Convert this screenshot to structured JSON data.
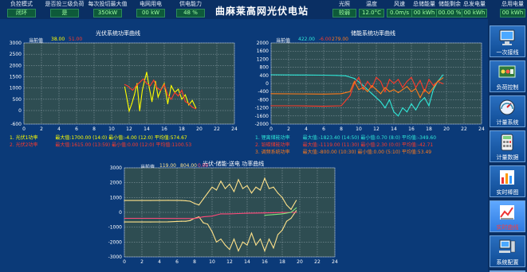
{
  "header": {
    "title": "曲麻莱高网光伏电站",
    "left_fields": [
      {
        "label": "负控模式",
        "value": "闭环"
      },
      {
        "label": "是否投三级负荷",
        "value": "是"
      },
      {
        "label": "每次投切最大值",
        "value": "350kW"
      },
      {
        "label": "电网用电",
        "value": "00 kW"
      },
      {
        "label": "供电能力",
        "value": "48 %"
      }
    ],
    "right_fields": [
      {
        "label": "光照",
        "value": "较弱"
      },
      {
        "label": "温度",
        "value": "12.0°C"
      },
      {
        "label": "风速",
        "value": "0.0m/s"
      },
      {
        "label": "总储能量",
        "value": "00 kWh"
      },
      {
        "label": "储能剩余",
        "value": "00.00 %"
      },
      {
        "label": "总发电量",
        "value": "00 kWh"
      },
      {
        "label": "总用电量",
        "value": "00 kWh"
      }
    ]
  },
  "sidebar": {
    "items": [
      {
        "label": "一次接线",
        "icon": "monitor-icon"
      },
      {
        "label": "负荷控制",
        "icon": "control-panel-icon"
      },
      {
        "label": "计量系统",
        "icon": "meter-icon"
      },
      {
        "label": "计量数据",
        "icon": "calculator-icon"
      },
      {
        "label": "实时棒图",
        "icon": "bar-chart-icon"
      },
      {
        "label": "实时曲线",
        "icon": "line-chart-icon"
      },
      {
        "label": "系统配置",
        "icon": "computer-icon"
      },
      {
        "label": "退出",
        "icon": "exit-icon"
      }
    ],
    "active_index": 5
  },
  "colors": {
    "panel": "#2e4d52",
    "grid": "#e6eef8",
    "yellow": "#ffff00",
    "red": "#ff3a2a",
    "cyan": "#2fe8d8",
    "orange": "#ff7a1a",
    "light_yellow": "#ffe28a",
    "pink_red": "#ff4a7a",
    "green": "#7ee37e"
  },
  "chart_data": [
    {
      "type": "line",
      "title": "光伏系统功率曲线",
      "current_label": "当前值",
      "current_values": [
        "38.00",
        "51.00"
      ],
      "xlim": [
        0,
        24
      ],
      "ylim": [
        -600,
        3000
      ],
      "xticks": [
        0,
        2,
        4,
        6,
        8,
        10,
        12,
        14,
        16,
        18,
        20,
        22,
        24
      ],
      "yticks": [
        -600,
        0,
        500,
        1000,
        1500,
        2000,
        2500,
        3000
      ],
      "series": [
        {
          "name": "1. 光伏1功率",
          "color": "#ffff00",
          "stats": "最大值:1700.00 (14:0)  最小值:-4.00 (12:0)  平均值:574.67",
          "points": [
            [
              11.5,
              1050
            ],
            [
              11.8,
              420
            ],
            [
              12.0,
              -20
            ],
            [
              12.3,
              300
            ],
            [
              12.6,
              700
            ],
            [
              12.9,
              1200
            ],
            [
              13.2,
              -10
            ],
            [
              13.5,
              900
            ],
            [
              13.8,
              1400
            ],
            [
              14.0,
              1700
            ],
            [
              14.3,
              1000
            ],
            [
              14.6,
              400
            ],
            [
              15.0,
              1300
            ],
            [
              15.3,
              600
            ],
            [
              15.6,
              900
            ],
            [
              16.0,
              1200
            ],
            [
              16.4,
              300
            ],
            [
              16.8,
              1100
            ],
            [
              17.2,
              800
            ],
            [
              17.6,
              950
            ],
            [
              18.0,
              500
            ],
            [
              18.4,
              700
            ],
            [
              18.8,
              250
            ],
            [
              19.2,
              450
            ],
            [
              19.6,
              120
            ]
          ]
        },
        {
          "name": "2. 光伏2功率",
          "color": "#ff3a2a",
          "stats": "最大值:1615.00 (13:59)  最小值:0.00 (12:0)  平均值:1100.53",
          "points": [
            [
              11.5,
              1150
            ],
            [
              11.8,
              1100
            ],
            [
              12.1,
              1000
            ],
            [
              12.4,
              900
            ],
            [
              12.8,
              1100
            ],
            [
              13.2,
              1250
            ],
            [
              13.6,
              1400
            ],
            [
              14.0,
              1200
            ],
            [
              14.4,
              1100
            ],
            [
              14.8,
              1350
            ],
            [
              15.2,
              1000
            ],
            [
              15.6,
              900
            ],
            [
              16.0,
              1150
            ],
            [
              16.4,
              700
            ],
            [
              16.8,
              500
            ],
            [
              17.2,
              800
            ],
            [
              17.6,
              650
            ],
            [
              18.0,
              900
            ],
            [
              18.4,
              400
            ],
            [
              18.8,
              300
            ],
            [
              19.2,
              150
            ],
            [
              19.6,
              80
            ]
          ]
        }
      ]
    },
    {
      "type": "line",
      "title": "储能系统功率曲线",
      "current_label": "当前值",
      "current_values": [
        "422.00",
        "-6.00",
        "279.00"
      ],
      "xlim": [
        0,
        24
      ],
      "ylim": [
        -2000,
        2000
      ],
      "xticks": [
        0,
        2,
        4,
        6,
        8,
        10,
        12,
        14,
        16,
        18,
        20,
        22,
        24
      ],
      "yticks": [
        -2000,
        -1600,
        -1200,
        -800,
        -400,
        0,
        400,
        800,
        1200,
        1600,
        2000
      ],
      "series": [
        {
          "name": "1. 锂离储能功率",
          "color": "#2fe8d8",
          "stats": "最大值:-1823.40 (14:50)  最小值:0.70 (8:0)  平均值:-349.60",
          "points": [
            [
              0,
              430
            ],
            [
              3,
              420
            ],
            [
              6,
              410
            ],
            [
              7.5,
              400
            ],
            [
              8.5,
              380
            ],
            [
              9.5,
              250
            ],
            [
              10.5,
              -100
            ],
            [
              11.5,
              -500
            ],
            [
              12.5,
              -900
            ],
            [
              13.0,
              -1200
            ],
            [
              13.5,
              -800
            ],
            [
              14.0,
              -1400
            ],
            [
              14.5,
              -1600
            ],
            [
              15.0,
              -1200
            ],
            [
              15.5,
              -1400
            ],
            [
              16.0,
              -1000
            ],
            [
              16.5,
              -1300
            ],
            [
              17.0,
              -900
            ],
            [
              17.5,
              -700
            ],
            [
              18.0,
              -1100
            ],
            [
              18.5,
              -300
            ],
            [
              19.0,
              100
            ],
            [
              19.6,
              422
            ]
          ]
        },
        {
          "name": "2. 铅碳储能功率",
          "color": "#ff3a2a",
          "stats": "最大值:-1119.00 (11:30)  最小值:2.30 (0:0)  平均值:-42.71",
          "points": [
            [
              0,
              -1100
            ],
            [
              3,
              -1100
            ],
            [
              6,
              -1120
            ],
            [
              8,
              -1100
            ],
            [
              9,
              -600
            ],
            [
              9.5,
              0
            ],
            [
              10,
              300
            ],
            [
              10.5,
              -300
            ],
            [
              11,
              100
            ],
            [
              11.5,
              -200
            ],
            [
              12,
              300
            ],
            [
              12.5,
              100
            ],
            [
              13,
              -400
            ],
            [
              13.5,
              200
            ],
            [
              14,
              0
            ],
            [
              14.5,
              200
            ],
            [
              15,
              -200
            ],
            [
              15.5,
              100
            ],
            [
              16,
              300
            ],
            [
              16.5,
              -200
            ],
            [
              17,
              150
            ],
            [
              17.5,
              -400
            ],
            [
              18,
              200
            ],
            [
              18.5,
              -100
            ],
            [
              19,
              100
            ],
            [
              19.6,
              -6
            ]
          ]
        },
        {
          "name": "3. 调频系统功率",
          "color": "#ff7a1a",
          "stats": "最大值:-800.00 (10:30)  最小值:0.00 (5:10)  平均值:53.49",
          "points": [
            [
              0,
              -500
            ],
            [
              6,
              -520
            ],
            [
              8,
              -500
            ],
            [
              9,
              -400
            ],
            [
              9.5,
              100
            ],
            [
              10,
              -300
            ],
            [
              10.5,
              -200
            ],
            [
              11,
              -400
            ],
            [
              11.5,
              -100
            ],
            [
              12,
              -300
            ],
            [
              12.5,
              -500
            ],
            [
              13,
              -200
            ],
            [
              13.5,
              -400
            ],
            [
              14,
              -300
            ],
            [
              14.5,
              -450
            ],
            [
              15,
              -300
            ],
            [
              15.5,
              -150
            ],
            [
              16,
              -400
            ],
            [
              16.5,
              -250
            ],
            [
              17,
              -700
            ],
            [
              17.5,
              -300
            ],
            [
              18,
              -500
            ],
            [
              18.5,
              -200
            ],
            [
              19,
              100
            ],
            [
              19.6,
              279
            ]
          ]
        }
      ]
    },
    {
      "type": "line",
      "title": "光伏-储能-送电 功率曲线",
      "current_label": "当前值",
      "current_values": [
        "119.00",
        "804.00",
        "0.00"
      ],
      "xlim": [
        0,
        24
      ],
      "ylim": [
        -3000,
        3000
      ],
      "xticks": [
        0,
        2,
        4,
        6,
        8,
        10,
        12,
        14,
        16,
        18,
        20,
        22,
        24
      ],
      "yticks": [
        -3000,
        -2000,
        -1000,
        0,
        1000,
        2000,
        3000
      ],
      "series": [
        {
          "name": "光伏总功率",
          "color": "#ffe28a",
          "points": [
            [
              0,
              -650
            ],
            [
              3,
              -650
            ],
            [
              5,
              -640
            ],
            [
              6.5,
              -600
            ],
            [
              7,
              -600
            ],
            [
              7.5,
              -550
            ],
            [
              8,
              -400
            ],
            [
              8.5,
              -300
            ],
            [
              9,
              -700
            ],
            [
              9.5,
              -800
            ],
            [
              10,
              -1300
            ],
            [
              10.5,
              -2000
            ],
            [
              11,
              -1800
            ],
            [
              11.5,
              -2200
            ],
            [
              12,
              -2500
            ],
            [
              12.5,
              -1800
            ],
            [
              13,
              -2600
            ],
            [
              13.5,
              -2000
            ],
            [
              14,
              -2200
            ],
            [
              14.5,
              -1400
            ],
            [
              15,
              -2200
            ],
            [
              15.5,
              -1800
            ],
            [
              16,
              -2600
            ],
            [
              16.5,
              -1800
            ],
            [
              17,
              -2400
            ],
            [
              17.5,
              -1500
            ],
            [
              18,
              -1200
            ],
            [
              18.5,
              -600
            ],
            [
              19,
              -400
            ],
            [
              19.6,
              119
            ]
          ]
        },
        {
          "name": "储能总功率",
          "color": "#ffe28a",
          "points": [
            [
              0,
              800
            ],
            [
              3,
              800
            ],
            [
              5,
              810
            ],
            [
              6.5,
              800
            ],
            [
              7,
              780
            ],
            [
              7.5,
              750
            ],
            [
              8,
              600
            ],
            [
              8.5,
              500
            ],
            [
              9,
              900
            ],
            [
              9.5,
              1300
            ],
            [
              10,
              1700
            ],
            [
              10.5,
              1500
            ],
            [
              11,
              2100
            ],
            [
              11.5,
              1600
            ],
            [
              12,
              1900
            ],
            [
              12.5,
              1400
            ],
            [
              13,
              2200
            ],
            [
              13.5,
              1600
            ],
            [
              14,
              1800
            ],
            [
              14.5,
              1300
            ],
            [
              15,
              1700
            ],
            [
              15.5,
              1500
            ],
            [
              16,
              2300
            ],
            [
              16.5,
              1600
            ],
            [
              17,
              1700
            ],
            [
              17.5,
              1300
            ],
            [
              18,
              1000
            ],
            [
              18.5,
              500
            ],
            [
              19,
              200
            ],
            [
              19.6,
              804
            ]
          ]
        },
        {
          "name": "送电功率",
          "color": "#ff4a7a",
          "points": [
            [
              0,
              -400
            ],
            [
              4,
              -400
            ],
            [
              8,
              -420
            ],
            [
              9,
              -300
            ],
            [
              10,
              -250
            ],
            [
              11,
              -100
            ],
            [
              12,
              -100
            ],
            [
              13,
              -80
            ],
            [
              14,
              -60
            ],
            [
              15,
              -50
            ],
            [
              16,
              -40
            ],
            [
              17,
              -20
            ],
            [
              18,
              -10
            ],
            [
              19.6,
              0
            ]
          ]
        },
        {
          "name": "参考线",
          "color": "#7ee37e",
          "points": [
            [
              16,
              -200
            ],
            [
              17,
              -150
            ],
            [
              18,
              -100
            ],
            [
              19,
              0
            ],
            [
              19.6,
              300
            ]
          ]
        }
      ]
    }
  ]
}
